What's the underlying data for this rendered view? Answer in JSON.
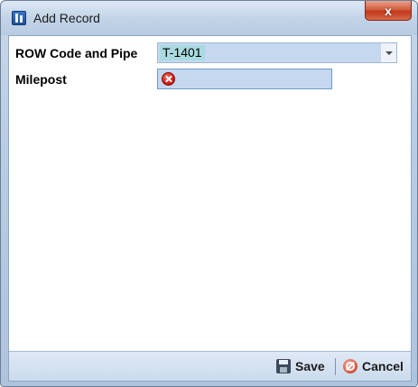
{
  "window": {
    "title": "Add Record",
    "close_glyph": "x"
  },
  "form": {
    "fields": [
      {
        "label": "ROW Code and Pipe",
        "value": "T-1401",
        "type": "combo"
      },
      {
        "label": "Milepost",
        "value": "",
        "type": "text",
        "status": "error"
      }
    ]
  },
  "footer": {
    "save_label": "Save",
    "cancel_label": "Cancel"
  },
  "icons": {
    "app": "app-icon",
    "close": "close-icon",
    "dropdown": "chevron-down-icon",
    "error": "error-icon",
    "save": "save-icon",
    "cancel": "cancel-icon"
  },
  "colors": {
    "field_bg": "#c5d8ef",
    "selection": "#a9dadf",
    "error": "#d2201a",
    "close_button": "#c0391b"
  }
}
